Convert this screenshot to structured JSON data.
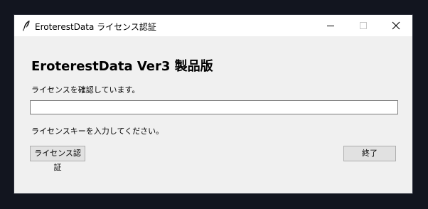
{
  "window": {
    "title": "EroterestData ライセンス認証",
    "icon": "feather-icon",
    "controls": {
      "minimize": "minimize-icon",
      "maximize": "maximize-icon",
      "close": "close-icon"
    }
  },
  "main": {
    "heading": "EroterestData Ver3 製品版",
    "status": "ライセンスを確認しています。",
    "license_key_value": "",
    "prompt": "ライセンスキーを入力してください。",
    "auth_button": "ライセンス認証",
    "exit_button": "終了"
  },
  "colors": {
    "desktop_background": "#12151f",
    "window_background": "#f0f0f0",
    "titlebar_background": "#ffffff",
    "button_background": "#e1e1e1"
  }
}
